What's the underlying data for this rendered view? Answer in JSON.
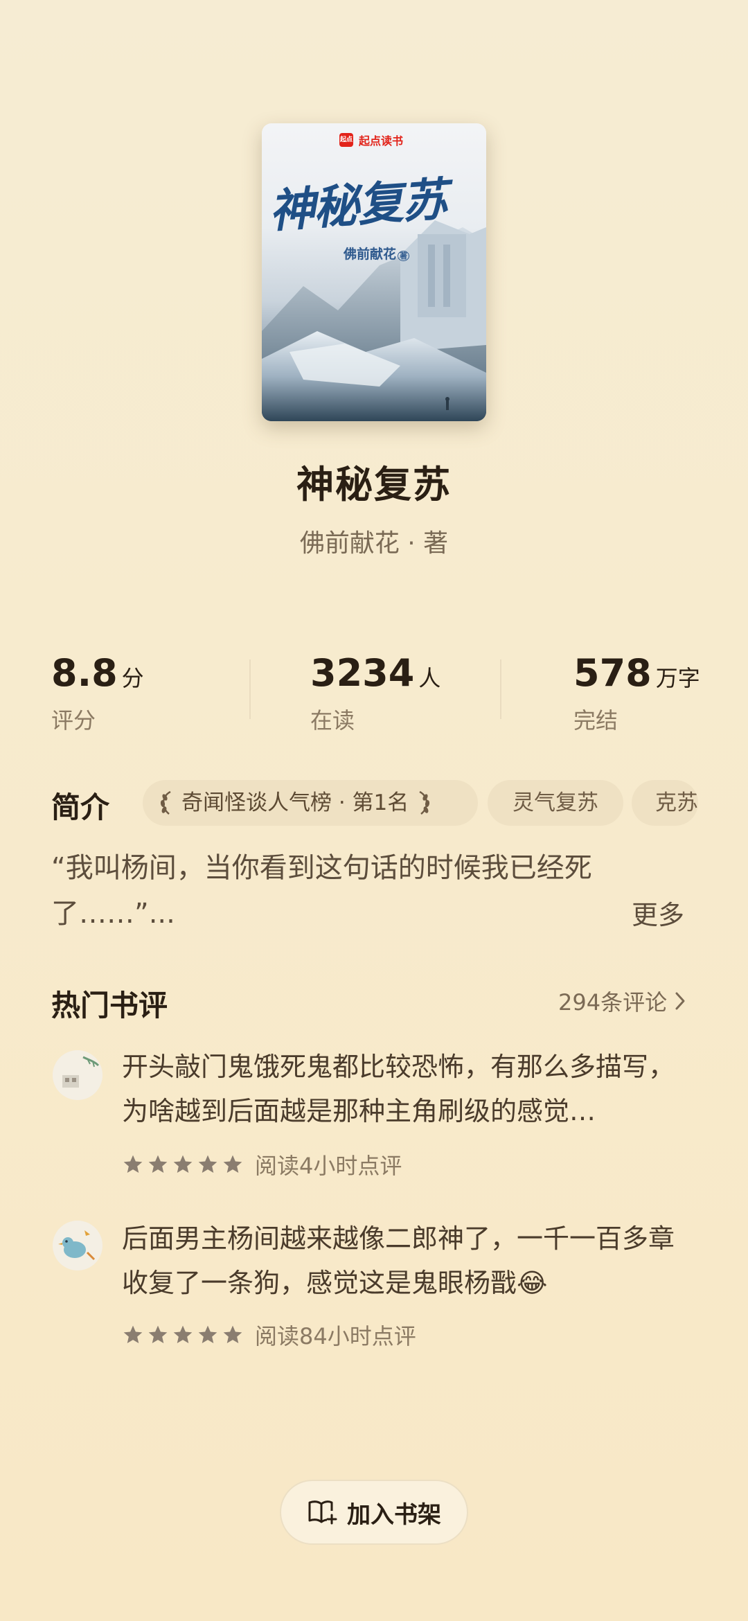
{
  "cover": {
    "brand": "起点读书",
    "brand_logo": "起点",
    "title": "神秘复苏",
    "author": "佛前献花",
    "author_badge": "著"
  },
  "book": {
    "title": "神秘复苏",
    "author_line": "佛前献花 · 著"
  },
  "stats": [
    {
      "value": "8.8",
      "unit": "分",
      "label": "评分"
    },
    {
      "value": "3234",
      "unit": "人",
      "label": "在读"
    },
    {
      "value": "578",
      "unit": "万字",
      "label": "完结"
    }
  ],
  "intro": {
    "heading": "简介",
    "tags": [
      {
        "label": "奇闻怪谈人气榜 · 第1名",
        "icon": "laurel-icon"
      },
      {
        "label": "灵气复苏"
      },
      {
        "label": "克苏"
      }
    ],
    "text": "“我叫杨间，当你看到这句话的时候我已经死了……”...",
    "more": "更多"
  },
  "reviews": {
    "heading": "热门书评",
    "count_label": "294条评论",
    "items": [
      {
        "text": "开头敲门鬼饿死鬼都比较恐怖，有那么多描写，为啥越到后面越是那种主角刷级的感觉…",
        "rating": 5,
        "meta": "阅读4小时点评",
        "avatar_icon": "landscape-avatar-icon"
      },
      {
        "text": "后面男主杨间越来越像二郎神了，一千一百多章收复了一条狗，感觉这是鬼眼杨戬😂",
        "rating": 5,
        "meta": "阅读84小时点评",
        "avatar_icon": "bird-avatar-icon"
      }
    ]
  },
  "actions": {
    "add_to_shelf": "加入书架",
    "add_to_shelf_icon": "book-add-icon"
  },
  "colors": {
    "background": "#f6ecd3",
    "primary_text": "#2a1f14",
    "secondary_text": "#8b7a63",
    "tag_bg": "#efe1c3",
    "star": "#8a7d70",
    "brand_red": "#e2231a"
  }
}
